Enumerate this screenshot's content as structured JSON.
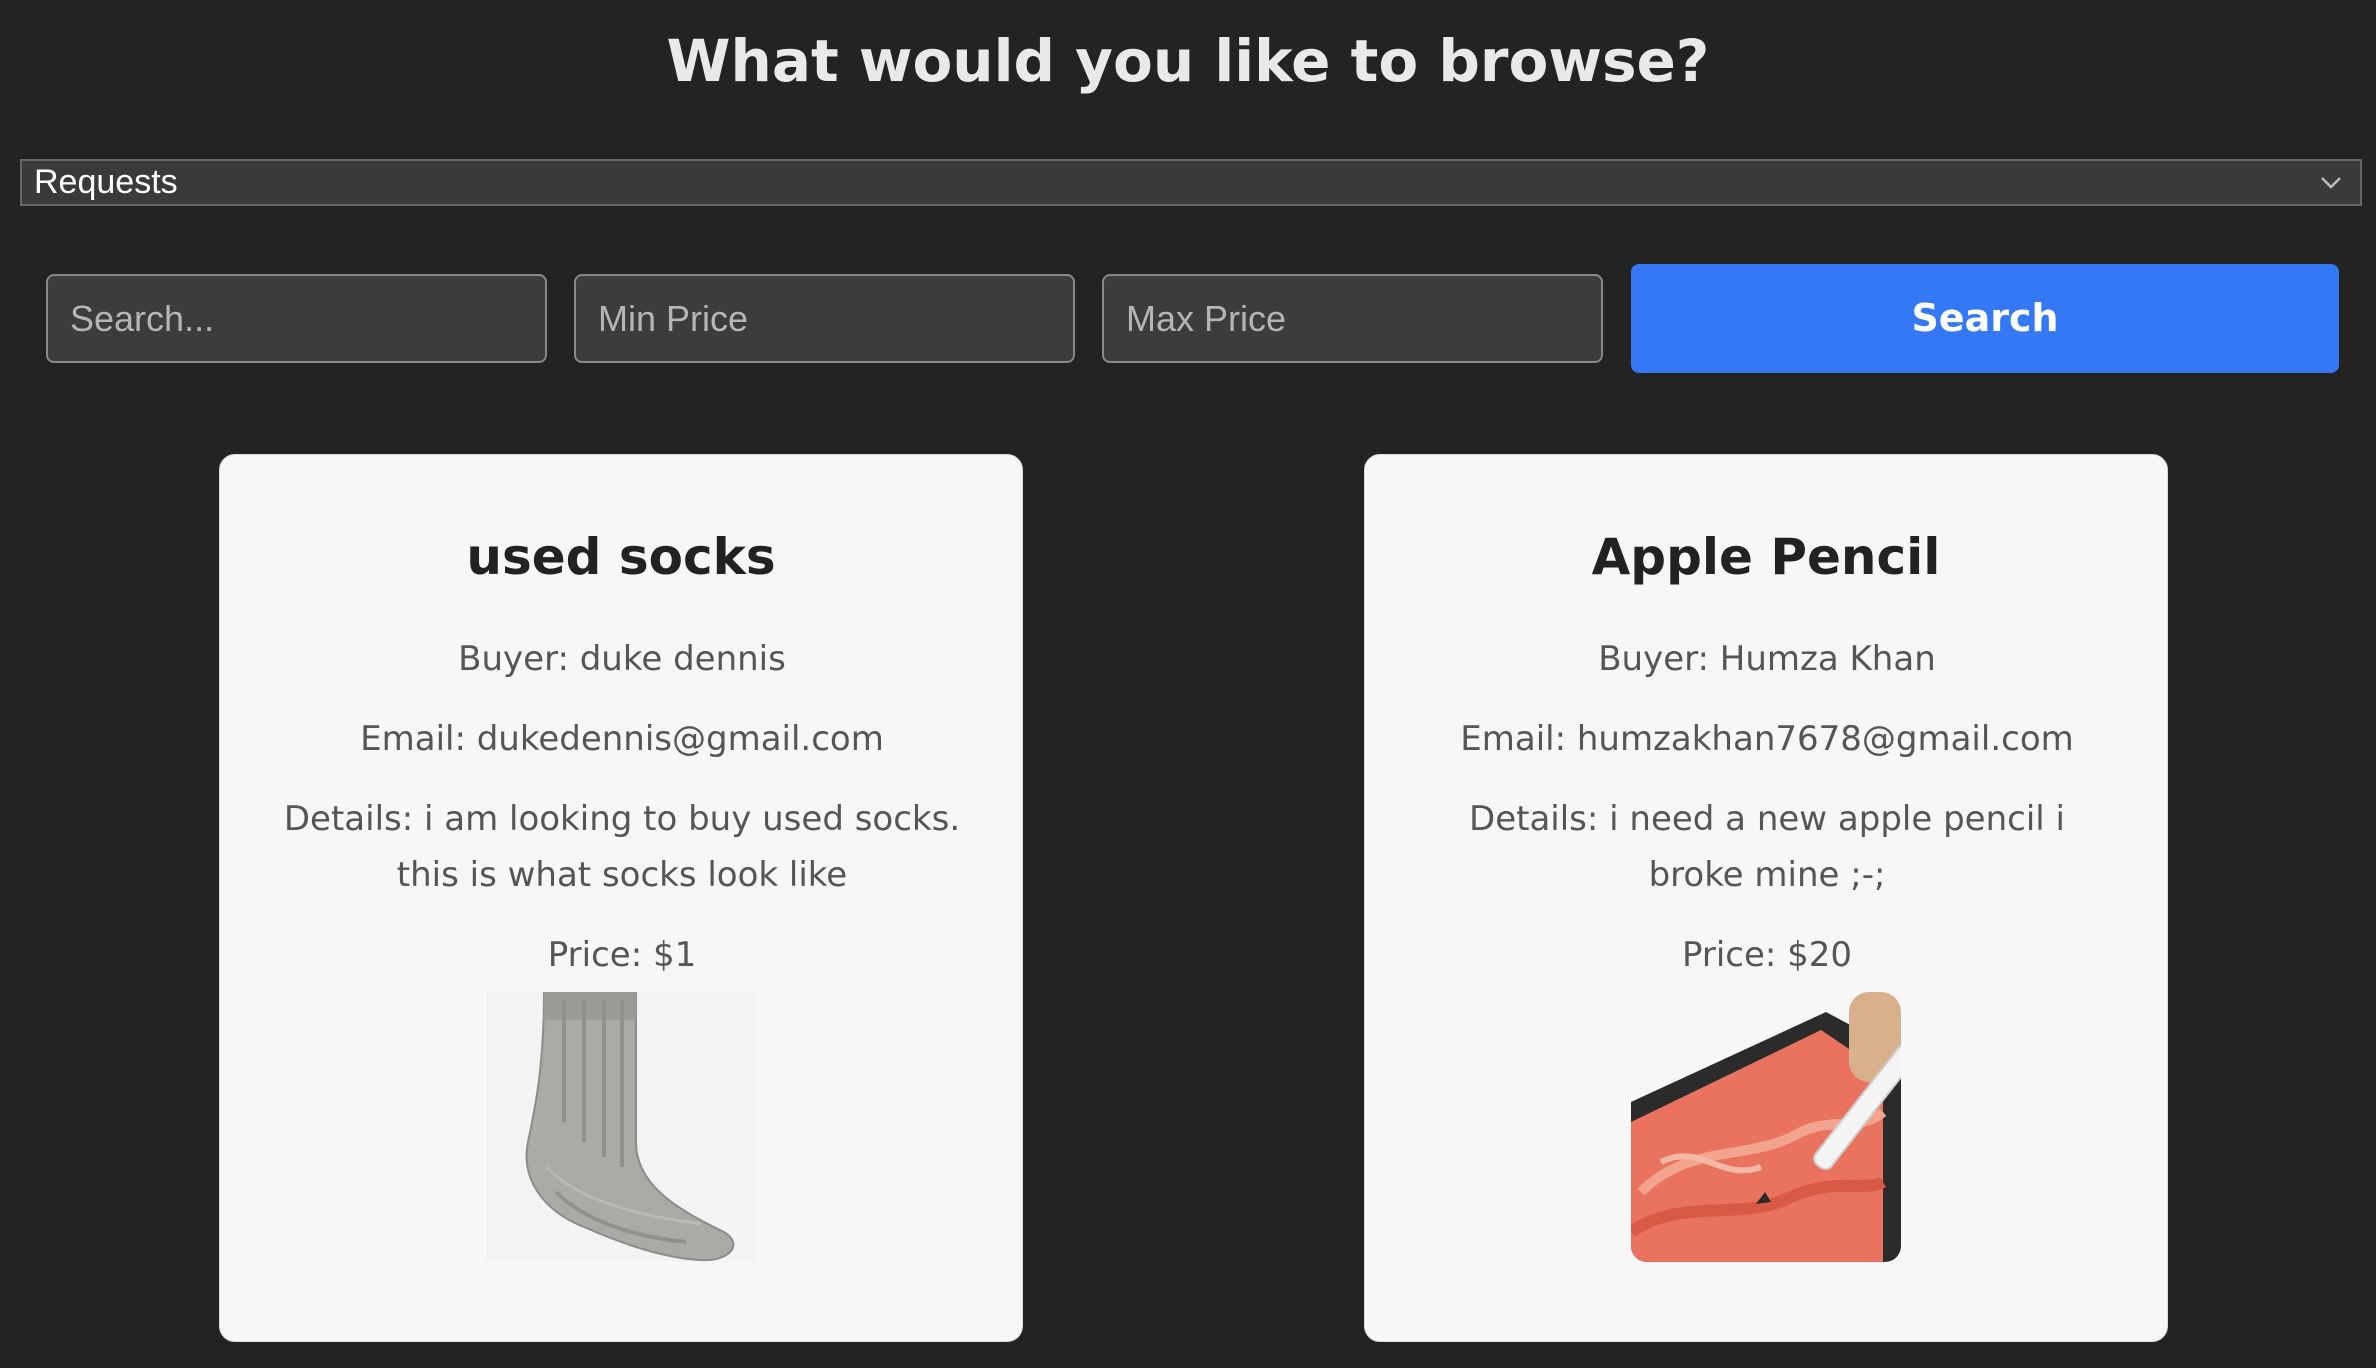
{
  "page": {
    "title": "What would you like to browse?"
  },
  "browse": {
    "selected": "Requests"
  },
  "filters": {
    "search_placeholder": "Search...",
    "min_price_placeholder": "Min Price",
    "max_price_placeholder": "Max Price",
    "search_button": "Search"
  },
  "colors": {
    "background": "#232323",
    "accent": "#3478f6",
    "card": "#f7f7f7"
  },
  "requests": [
    {
      "title": "used socks",
      "buyer": "Buyer: duke dennis",
      "email": "Email: dukedennis@gmail.com",
      "details_1": "Details: i am looking to buy used socks.",
      "details_2": "this is what socks look like",
      "price": "Price: $1",
      "image": "sock-photo"
    },
    {
      "title": "Apple Pencil",
      "buyer": "Buyer: Humza Khan",
      "email": "Email: humzakhan7678@gmail.com",
      "details_1": "Details: i need a new apple pencil i",
      "details_2": "broke mine ;-;",
      "price": "Price: $20",
      "image": "apple-pencil-photo"
    }
  ]
}
